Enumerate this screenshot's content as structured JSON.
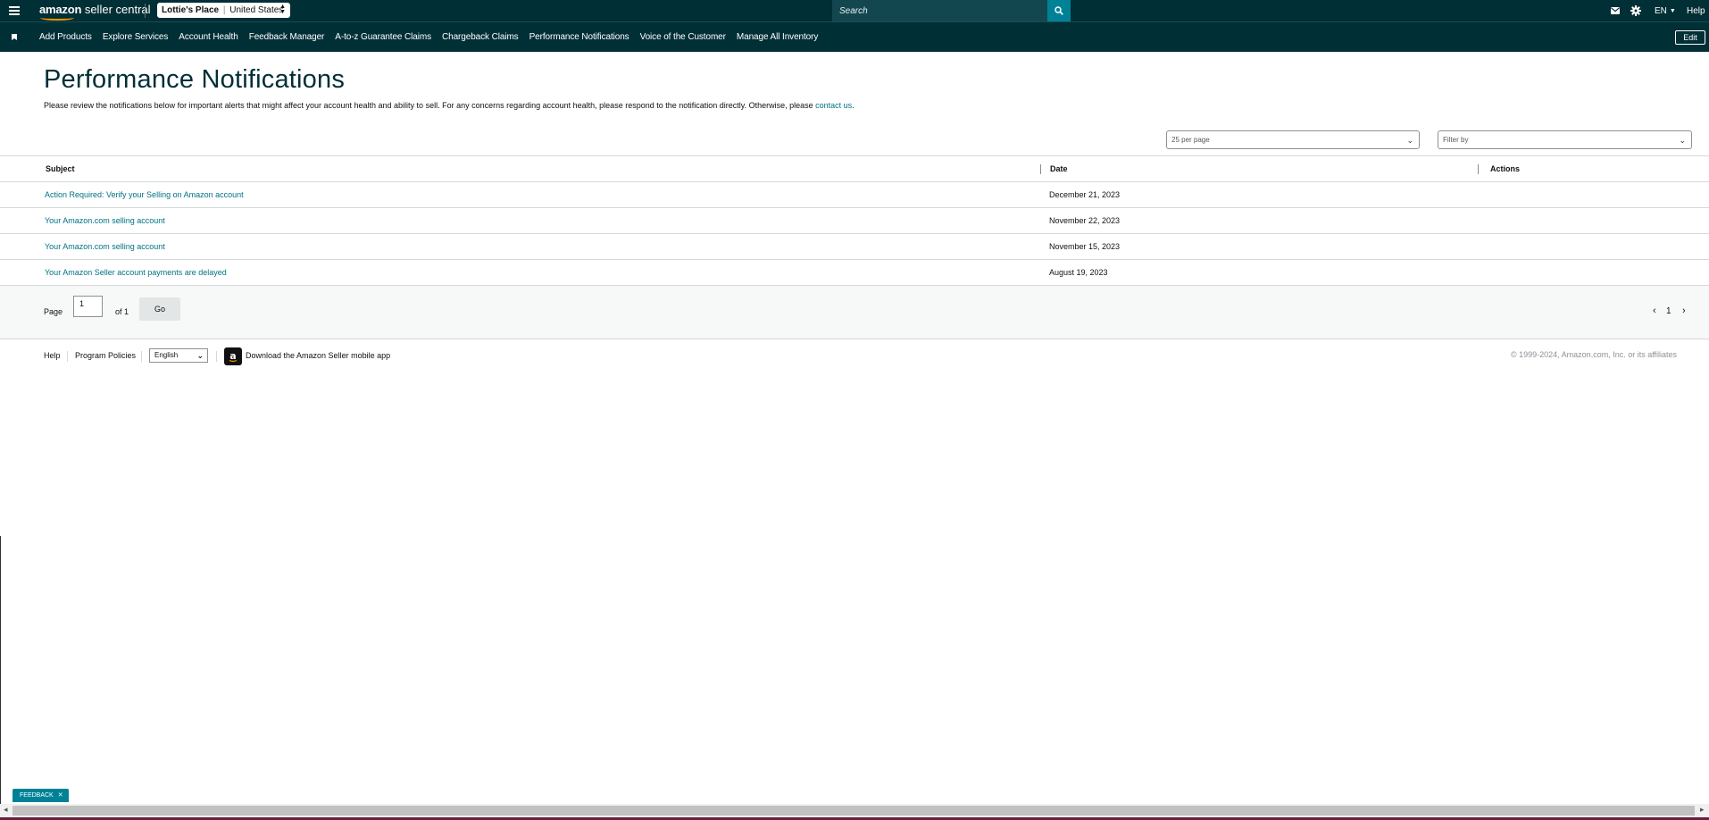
{
  "header": {
    "logo_brand": "amazon",
    "logo_product": "seller central",
    "account_name": "Lottie's Place",
    "account_separator": "|",
    "account_region": "United States",
    "search_placeholder": "Search",
    "language": "EN",
    "help_label": "Help"
  },
  "nav": {
    "items": [
      "Add Products",
      "Explore Services",
      "Account Health",
      "Feedback Manager",
      "A-to-z Guarantee Claims",
      "Chargeback Claims",
      "Performance Notifications",
      "Voice of the Customer",
      "Manage All Inventory"
    ],
    "edit_label": "Edit"
  },
  "page": {
    "title": "Performance Notifications",
    "intro_text": "Please review the notifications below for important alerts that might affect your account health and ability to sell. For any concerns regarding account health, please respond to the notification directly. Otherwise, please ",
    "intro_link": "contact us",
    "intro_end": "."
  },
  "filters": {
    "per_page": "25 per page",
    "filter_placeholder": "Filter by"
  },
  "table": {
    "columns": {
      "subject": "Subject",
      "date": "Date",
      "actions": "Actions"
    },
    "rows": [
      {
        "subject": "Action Required: Verify your Selling on Amazon account",
        "date": "December 21, 2023"
      },
      {
        "subject": "Your Amazon.com selling account",
        "date": "November 22, 2023"
      },
      {
        "subject": "Your Amazon.com selling account",
        "date": "November 15, 2023"
      },
      {
        "subject": "Your Amazon Seller account payments are delayed",
        "date": "August 19, 2023"
      }
    ]
  },
  "pagination": {
    "page_label": "Page",
    "page_value": "1",
    "of_label": "of 1",
    "go_label": "Go",
    "current_page": "1"
  },
  "footer": {
    "help": "Help",
    "program_policies": "Program Policies",
    "language_select": "English",
    "app_download": "Download the Amazon Seller mobile app",
    "copyright": "© 1999-2024, Amazon.com, Inc. or its affiliates"
  },
  "feedback": {
    "label": "FEEDBACK",
    "close": "✕"
  },
  "colors": {
    "header_bg": "#002f36",
    "search_bg": "#13474f",
    "accent_teal": "#008296",
    "link": "#007185",
    "logo_smile": "#ff9900"
  }
}
